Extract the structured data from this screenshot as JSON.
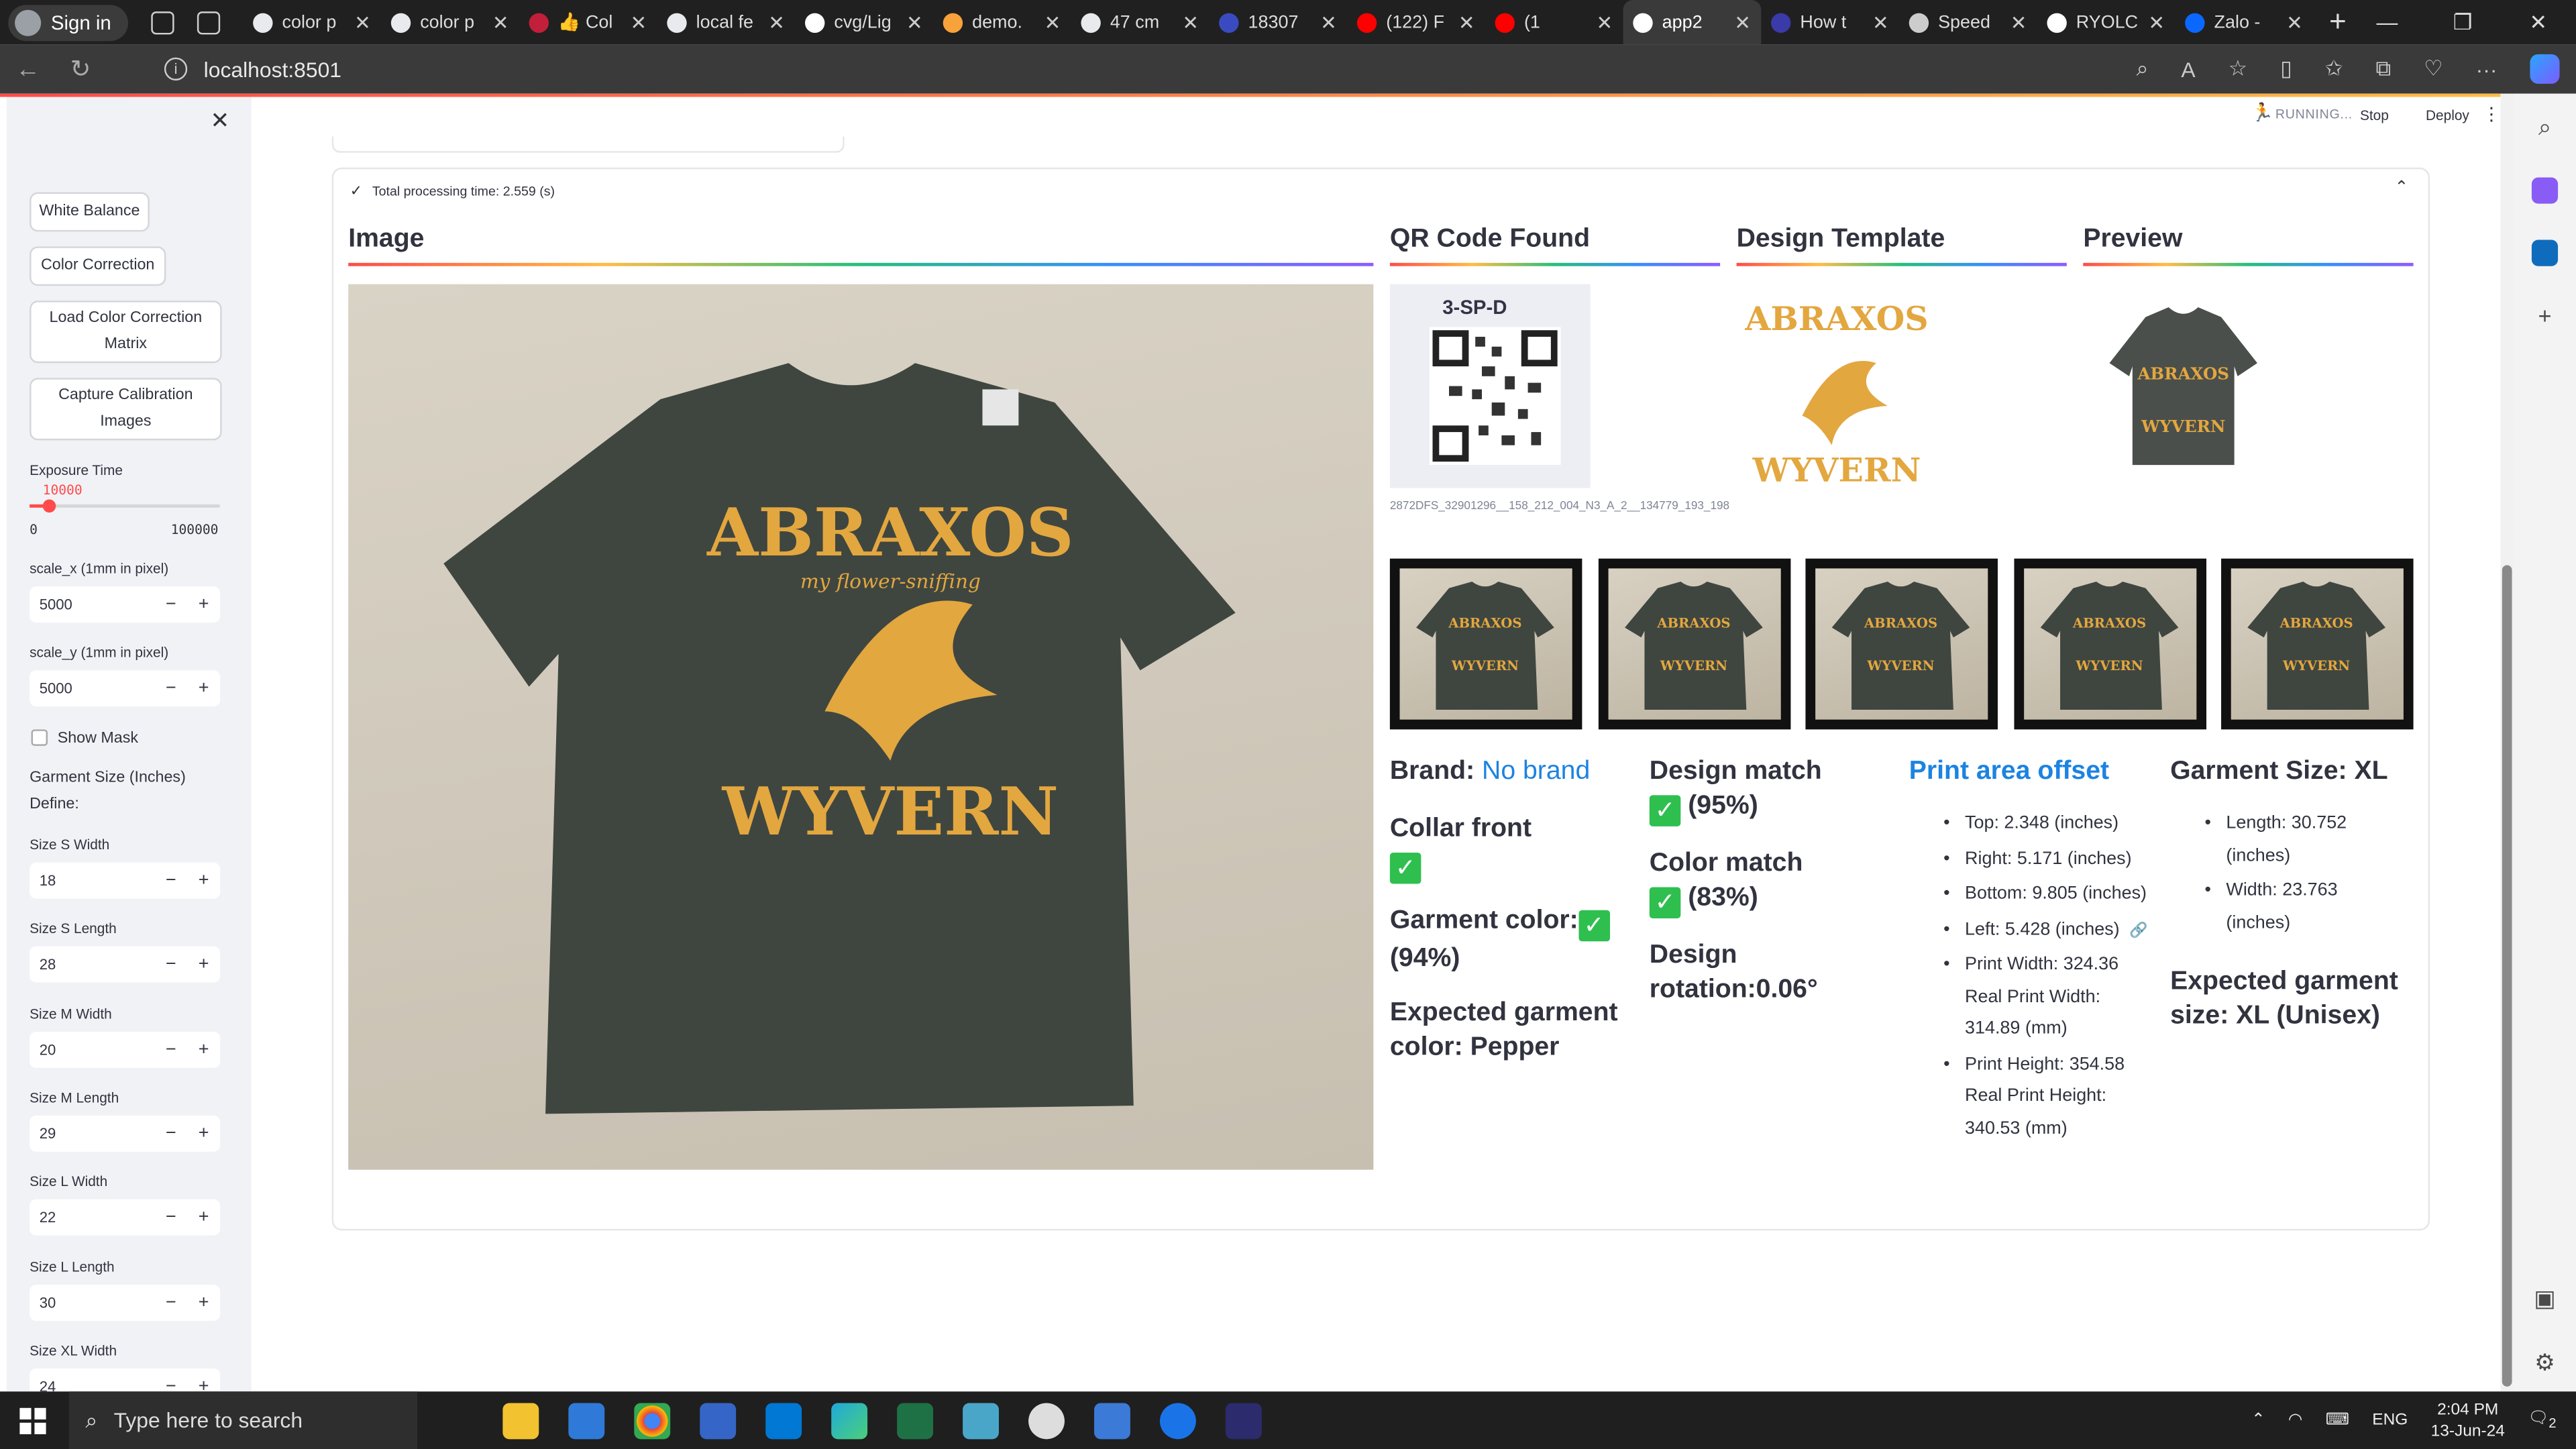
{
  "browser": {
    "profile_label": "Sign in",
    "tabs": [
      {
        "label": "color p",
        "icon": "chrome-icon",
        "color": "#e8eaed"
      },
      {
        "label": "color p",
        "icon": "chrome-icon",
        "color": "#e8eaed"
      },
      {
        "label": "👍 Col",
        "icon": "ext-icon",
        "color": "#c21f3a"
      },
      {
        "label": "local fe",
        "icon": "chrome-icon",
        "color": "#e8eaed"
      },
      {
        "label": "cvg/Lig",
        "icon": "github-icon",
        "color": "#ffffff"
      },
      {
        "label": "demo.",
        "icon": "infinity-icon",
        "color": "#f7a23b"
      },
      {
        "label": "47 cm",
        "icon": "chrome-icon",
        "color": "#e8eaed"
      },
      {
        "label": "18307",
        "icon": "app-icon",
        "color": "#3a4bc2"
      },
      {
        "label": "(122) F",
        "icon": "youtube-icon",
        "color": "#ff0000"
      },
      {
        "label": "(1",
        "icon": "youtube-icon",
        "color": "#ff0000"
      },
      {
        "label": "app2",
        "icon": "streamlit-icon",
        "color": "#ffffff"
      },
      {
        "label": "How t",
        "icon": "vscode-icon",
        "color": "#3a3aa8"
      },
      {
        "label": "Speed",
        "icon": "github-icon",
        "color": "#cccccc"
      },
      {
        "label": "RYOLC",
        "icon": "github-icon",
        "color": "#ffffff"
      },
      {
        "label": "Zalo -",
        "icon": "zalo-icon",
        "color": "#0a68ff"
      }
    ],
    "url": "localhost:8501"
  },
  "app": {
    "status": "RUNNING...",
    "stop_label": "Stop",
    "deploy_label": "Deploy"
  },
  "sidebar": {
    "buttons": {
      "white_balance": "White Balance",
      "color_correction": "Color Correction",
      "load_ccm_line1": "Load Color Correction",
      "load_ccm_line2": "Matrix",
      "capture_line1": "Capture Calibration",
      "capture_line2": "Images"
    },
    "exposure": {
      "label": "Exposure Time",
      "value": "10000",
      "min": "0",
      "max": "100000",
      "fraction": 0.1
    },
    "scale_x": {
      "label": "scale_x (1mm in pixel)",
      "value": "5000"
    },
    "scale_y": {
      "label": "scale_y (1mm in pixel)",
      "value": "5000"
    },
    "show_mask": "Show Mask",
    "garment_heading": "Garment Size (Inches)",
    "define": "Define:",
    "sizes": [
      {
        "label": "Size S Width",
        "value": "18"
      },
      {
        "label": "Size S Length",
        "value": "28"
      },
      {
        "label": "Size M Width",
        "value": "20"
      },
      {
        "label": "Size M Length",
        "value": "29"
      },
      {
        "label": "Size L Width",
        "value": "22"
      },
      {
        "label": "Size L Length",
        "value": "30"
      },
      {
        "label": "Size XL Width",
        "value": "24"
      }
    ]
  },
  "results": {
    "processing": "Total processing time: 2.559 (s)",
    "headers": {
      "image": "Image",
      "qr": "QR Code Found",
      "design": "Design Template",
      "preview": "Preview"
    },
    "shirt_text": {
      "top": "ABRAXOS",
      "sub": "my flower-sniffing",
      "bottom": "WYVERN"
    },
    "qr_code_label": "3-SP-D",
    "qr_caption": "2872DFS_32901296__158_212_004_N3_A_2__134779_193_198",
    "brand_label": "Brand:",
    "brand_value": "No brand",
    "collar_front": "Collar front",
    "garment_color_label": "Garment color:",
    "garment_color_pct": "(94%)",
    "expected_color": "Expected garment color: Pepper",
    "design_match_label": "Design match",
    "design_match_pct": "(95%)",
    "color_match_label": "Color match",
    "color_match_pct": "(83%)",
    "design_rotation": "Design rotation:0.06°",
    "print_offset_title": "Print area offset",
    "offsets": [
      "Top: 2.348 (inches)",
      "Right: 5.171 (inches)",
      "Bottom: 9.805 (inches)",
      "Left: 5.428 (inches)",
      "Print Width: 324.36 Real Print Width: 314.89 (mm)",
      "Print Height: 354.58 Real Print Height: 340.53 (mm)"
    ],
    "garment_size_title": "Garment Size: XL",
    "size_items": [
      "Length: 30.752 (inches)",
      "Width: 23.763 (inches)"
    ],
    "expected_size": "Expected garment size: XL (Unisex)"
  },
  "taskbar": {
    "search_placeholder": "Type here to search",
    "lang": "ENG",
    "time": "2:04 PM",
    "date": "13-Jun-24",
    "notification_count": "2"
  },
  "colors": {
    "accent": "#ff4b4b",
    "shirt": "#3f4640",
    "print": "#e3a73f",
    "link": "#1c83e1",
    "check": "#2fbf4f"
  }
}
